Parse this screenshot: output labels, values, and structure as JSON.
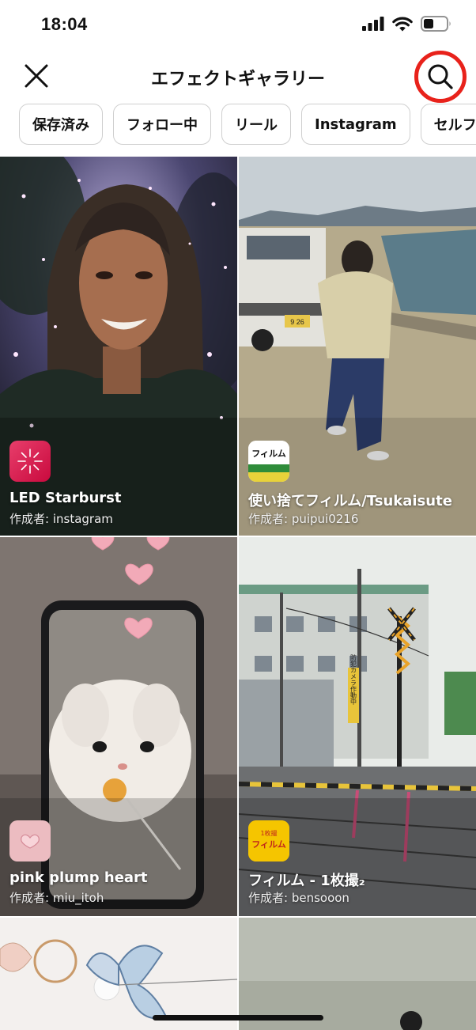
{
  "status_bar": {
    "time": "18:04"
  },
  "nav": {
    "title": "エフェクトギャラリー"
  },
  "chips": [
    "保存済み",
    "フォロー中",
    "リール",
    "Instagram",
    "セルフ"
  ],
  "author_prefix": "作成者: ",
  "effects": [
    {
      "name": "LED Starburst",
      "author": "instagram",
      "badge_icon": "starburst-icon"
    },
    {
      "name": "使い捨てフィルム/Tsukaisute",
      "author": "puipui0216",
      "badge_icon": "film-box-icon",
      "badge_text": "フィルム"
    },
    {
      "name": "pink plump heart",
      "author": "miu_itoh",
      "badge_icon": "heart-icon"
    },
    {
      "name": "フィルム - 1枚撮₂",
      "author": "bensooon",
      "badge_icon": "film-box-icon",
      "badge_text": "フィルム",
      "badge_subtext": "1枚撮"
    }
  ],
  "sign_text": "防犯カメラ作動中",
  "plate_text": "9 26",
  "colors": {
    "accent_red": "#e8221b",
    "chip_border": "#cfcfcf",
    "text": "#111111"
  }
}
